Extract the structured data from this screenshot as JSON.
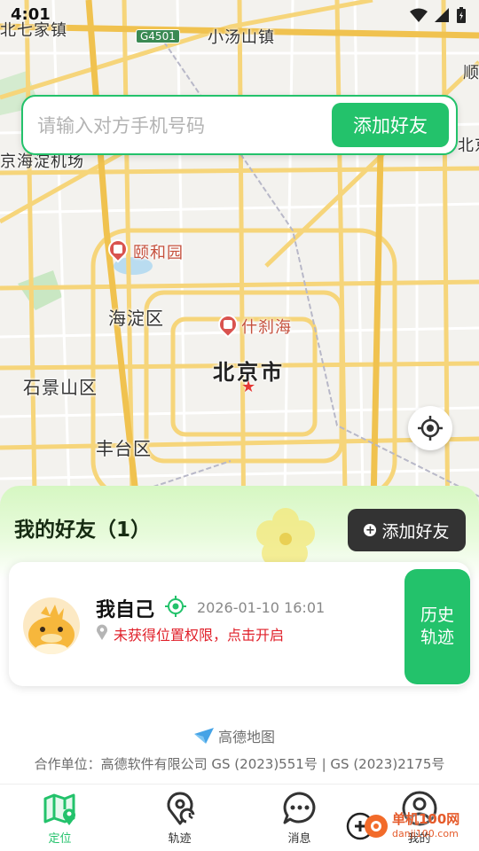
{
  "status_bar": {
    "time": "4:01"
  },
  "map": {
    "labels": {
      "xiaotangshan": "小汤山镇",
      "top_left_town": "北七家镇",
      "haidian_airport": "京海淀机场",
      "shun": "顺",
      "beijing_intl": "北京首都国际机场",
      "summer_palace": "颐和园",
      "haidian": "海淀区",
      "shichahai": "什刹海",
      "beijing": "北京市",
      "shijingshan": "石景山区",
      "fengtai": "丰台区",
      "highway": "G4501"
    }
  },
  "search": {
    "placeholder": "请输入对方手机号码",
    "value": "",
    "button_label": "添加好友"
  },
  "friends_panel": {
    "title": "我的好友（1）",
    "add_button_label": "添加好友",
    "friends": [
      {
        "name": "我自己",
        "timestamp": "2026-01-10 16:01",
        "warning": "未获得位置权限，点击开启",
        "history_label_line1": "历史",
        "history_label_line2": "轨迹"
      }
    ]
  },
  "footer": {
    "amap_logo_text": "高德地图",
    "partner_text": "合作单位：高德软件有限公司 GS (2023)551号 | GS (2023)2175号"
  },
  "nav": {
    "items": [
      {
        "label": "定位",
        "icon": "map-location-icon",
        "active": true
      },
      {
        "label": "轨迹",
        "icon": "track-icon",
        "active": false
      },
      {
        "label": "消息",
        "icon": "message-icon",
        "active": false
      },
      {
        "label": "我的",
        "icon": "profile-icon",
        "active": false
      }
    ]
  },
  "watermark": {
    "text": "单机100网",
    "sub": "danji100.com"
  },
  "colors": {
    "accent": "#23c26b",
    "dark_button": "#333333",
    "warning": "#e0202a"
  }
}
